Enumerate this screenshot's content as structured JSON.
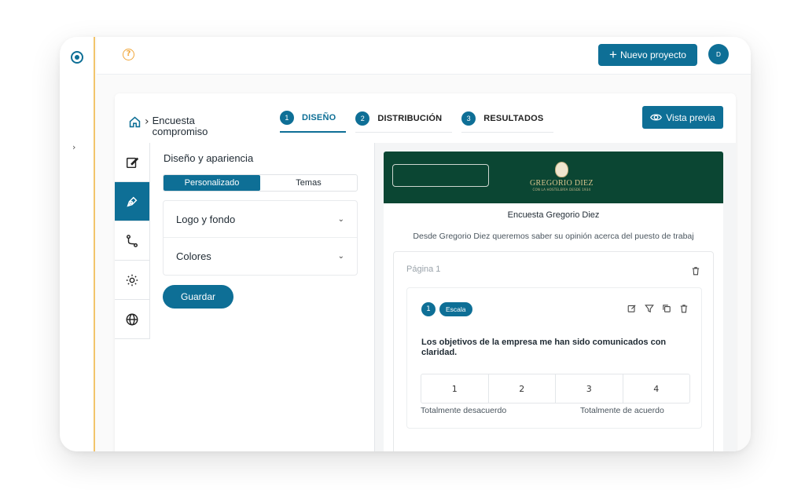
{
  "topbar": {
    "help_icon": "question-circle-icon",
    "new_project_label": "Nuevo proyecto",
    "avatar_initial": "D"
  },
  "breadcrumb": {
    "title": "Encuesta compromiso"
  },
  "steps": [
    {
      "number": "1",
      "label": "DISEÑO",
      "active": true
    },
    {
      "number": "2",
      "label": "DISTRIBUCIÓN",
      "active": false
    },
    {
      "number": "3",
      "label": "RESULTADOS",
      "active": false
    }
  ],
  "preview_label": "Vista previa",
  "design": {
    "heading": "Diseño y apariencia",
    "segments": [
      "Personalizado",
      "Temas"
    ],
    "sections": [
      "Logo y fondo",
      "Colores"
    ],
    "save_label": "Guardar"
  },
  "survey": {
    "brand": "GREGORIO DIEZ",
    "brand_sub": "CON LA HOSTELERÍA DESDE 1934",
    "title": "Encuesta Gregorio Diez",
    "description": "Desde Gregorio Diez queremos saber su opinión acerca del puesto de trabaj",
    "page_label": "Página 1",
    "question": {
      "number": "1",
      "type": "Escala",
      "text": "Los objetivos de la empresa me han sido comunicados con claridad.",
      "scale": [
        "1",
        "2",
        "3",
        "4"
      ],
      "label_min": "Totalmente desacuerdo",
      "label_max": "Totalmente de acuerdo"
    }
  },
  "colors": {
    "accent": "#0e6f96",
    "banner": "#0b4633",
    "help": "#f0a63a"
  }
}
